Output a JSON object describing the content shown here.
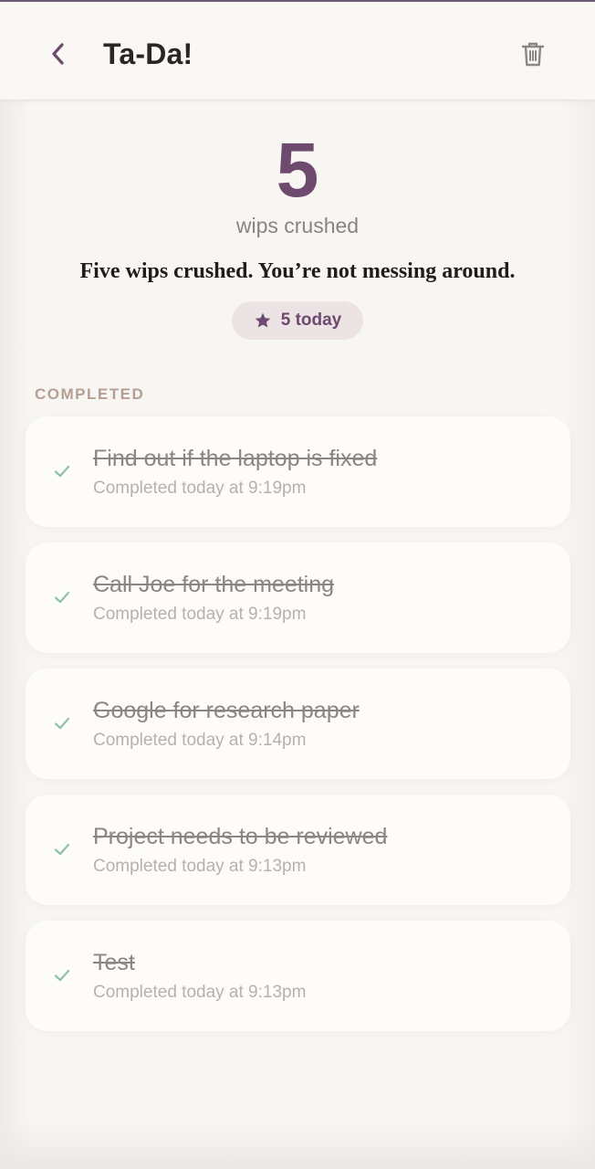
{
  "header": {
    "title": "Ta-Da!"
  },
  "stats": {
    "count": "5",
    "label": "wips crushed",
    "quip": "Five wips crushed. You’re not messing around.",
    "badge": "5 today"
  },
  "section": {
    "label": "COMPLETED"
  },
  "items": [
    {
      "title": "Find out if the laptop is fixed",
      "meta": "Completed today at 9:19pm"
    },
    {
      "title": "Call Joe for the meeting",
      "meta": "Completed today at 9:19pm"
    },
    {
      "title": "Google for research paper",
      "meta": "Completed today at 9:14pm"
    },
    {
      "title": "Project needs to be reviewed",
      "meta": "Completed today at 9:13pm"
    },
    {
      "title": "Test",
      "meta": "Completed today at 9:13pm"
    }
  ],
  "icons": {
    "back": "chevron-left-icon",
    "trash": "trash-icon",
    "badge": "star-icon",
    "item": "check-icon"
  },
  "colors": {
    "accent": "#6e4a6e",
    "check": "#8fc0ad",
    "badge_bg": "#ece3e5"
  }
}
